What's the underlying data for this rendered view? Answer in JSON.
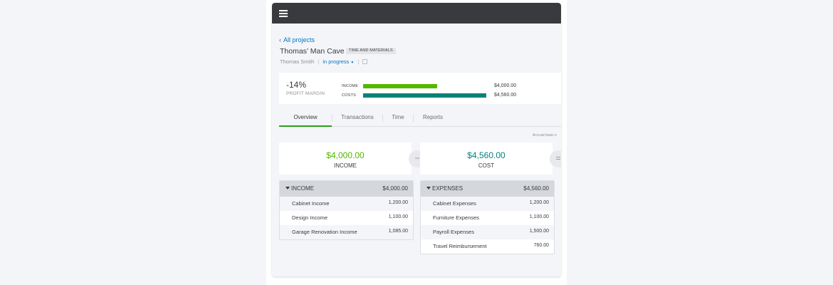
{
  "project": {
    "back_label": "All projects",
    "title": "Thomas’ Man Cave",
    "type_tag": "TIME AND MATERIALS",
    "customer": "Thomas Smith",
    "status": "in progress"
  },
  "summary": {
    "profit_margin_value": "-14%",
    "profit_margin_label": "PROFIT MARGIN",
    "income_label": "INCOME",
    "income_amount": "$4,000.00",
    "income_fraction": 0.6,
    "costs_label": "COSTS",
    "costs_amount": "$4,560.00",
    "costs_fraction": 1.0
  },
  "tabs": [
    {
      "label": "Overview",
      "active": true
    },
    {
      "label": "Transactions",
      "active": false
    },
    {
      "label": "Time",
      "active": false
    },
    {
      "label": "Reports",
      "active": false
    }
  ],
  "accrual_note": "Accrual basis e",
  "totals": {
    "income_amount": "$4,000.00",
    "income_label": "INCOME",
    "cost_amount": "$4,560.00",
    "cost_label": "COST",
    "minus_symbol": "−",
    "equals_symbol": "="
  },
  "income_table": {
    "header_label": "INCOME",
    "header_amount": "$4,000.00",
    "rows": [
      {
        "label": "Cabinet Income",
        "amount": "1,200.00"
      },
      {
        "label": "Design Income",
        "amount": "1,100.00"
      },
      {
        "label": "Garage Renovation Income",
        "amount": "1,085.00"
      }
    ]
  },
  "expenses_table": {
    "header_label": "EXPENSES",
    "header_amount": "$4,560.00",
    "rows": [
      {
        "label": "Cabinet Expenses",
        "amount": "1,200.00"
      },
      {
        "label": "Furniture Expenses",
        "amount": "1,100.00"
      },
      {
        "label": "Payroll Expenses",
        "amount": "1,500.00"
      },
      {
        "label": "Travel Reimbursement",
        "amount": "760.00"
      }
    ]
  },
  "colors": {
    "income": "#53b700",
    "costs": "#00837a",
    "link": "#0077c5",
    "active_tab": "#2ca01c"
  }
}
